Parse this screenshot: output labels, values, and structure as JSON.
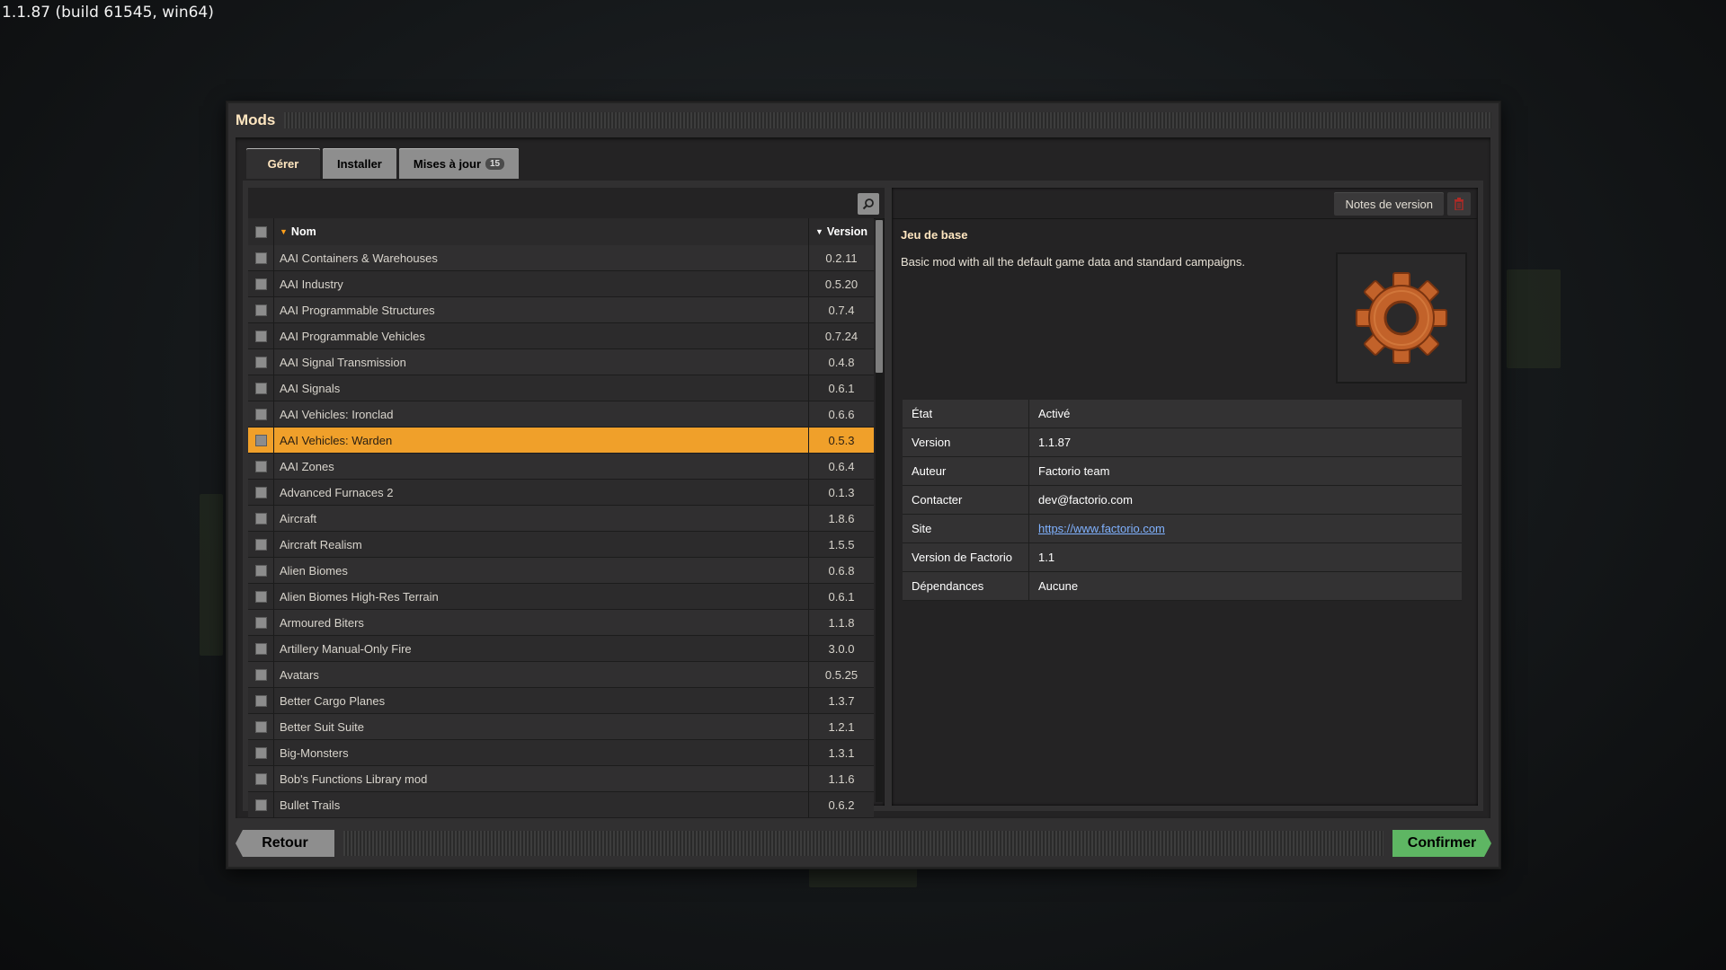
{
  "build_info": "1.1.87 (build 61545, win64)",
  "window": {
    "title": "Mods"
  },
  "tabs": [
    {
      "label": "Gérer"
    },
    {
      "label": "Installer"
    },
    {
      "label": "Mises à jour",
      "badge": "15"
    }
  ],
  "mod_list": {
    "headers": {
      "name": "Nom",
      "version": "Version"
    },
    "rows": [
      {
        "name": "AAI Containers & Warehouses",
        "version": "0.2.11"
      },
      {
        "name": "AAI Industry",
        "version": "0.5.20"
      },
      {
        "name": "AAI Programmable Structures",
        "version": "0.7.4"
      },
      {
        "name": "AAI Programmable Vehicles",
        "version": "0.7.24"
      },
      {
        "name": "AAI Signal Transmission",
        "version": "0.4.8"
      },
      {
        "name": "AAI Signals",
        "version": "0.6.1"
      },
      {
        "name": "AAI Vehicles: Ironclad",
        "version": "0.6.6"
      },
      {
        "name": "AAI Vehicles: Warden",
        "version": "0.5.3"
      },
      {
        "name": "AAI Zones",
        "version": "0.6.4"
      },
      {
        "name": "Advanced Furnaces 2",
        "version": "0.1.3"
      },
      {
        "name": "Aircraft",
        "version": "1.8.6"
      },
      {
        "name": "Aircraft Realism",
        "version": "1.5.5"
      },
      {
        "name": "Alien Biomes",
        "version": "0.6.8"
      },
      {
        "name": "Alien Biomes High-Res Terrain",
        "version": "0.6.1"
      },
      {
        "name": "Armoured Biters",
        "version": "1.1.8"
      },
      {
        "name": "Artillery Manual-Only Fire",
        "version": "3.0.0"
      },
      {
        "name": "Avatars",
        "version": "0.5.25"
      },
      {
        "name": "Better Cargo Planes",
        "version": "1.3.7"
      },
      {
        "name": "Better Suit Suite",
        "version": "1.2.1"
      },
      {
        "name": "Big-Monsters",
        "version": "1.3.1"
      },
      {
        "name": "Bob's Functions Library mod",
        "version": "1.1.6"
      },
      {
        "name": "Bullet Trails",
        "version": "0.6.2"
      }
    ]
  },
  "details": {
    "notes_button": "Notes de version",
    "title": "Jeu de base",
    "description": "Basic mod with all the default game data and standard campaigns.",
    "info": [
      {
        "key": "État",
        "value": "Activé"
      },
      {
        "key": "Version",
        "value": "1.1.87"
      },
      {
        "key": "Auteur",
        "value": "Factorio team"
      },
      {
        "key": "Contacter",
        "value": "dev@factorio.com"
      },
      {
        "key": "Site",
        "value": "https://www.factorio.com"
      },
      {
        "key": "Version de Factorio",
        "value": "1.1"
      },
      {
        "key": "Dépendances",
        "value": "Aucune"
      }
    ]
  },
  "buttons": {
    "back": "Retour",
    "confirm": "Confirmer"
  },
  "colors": {
    "accent": "#f0a02a",
    "confirm": "#5eb663",
    "title": "#ffe6c0",
    "link": "#80b2ff"
  }
}
